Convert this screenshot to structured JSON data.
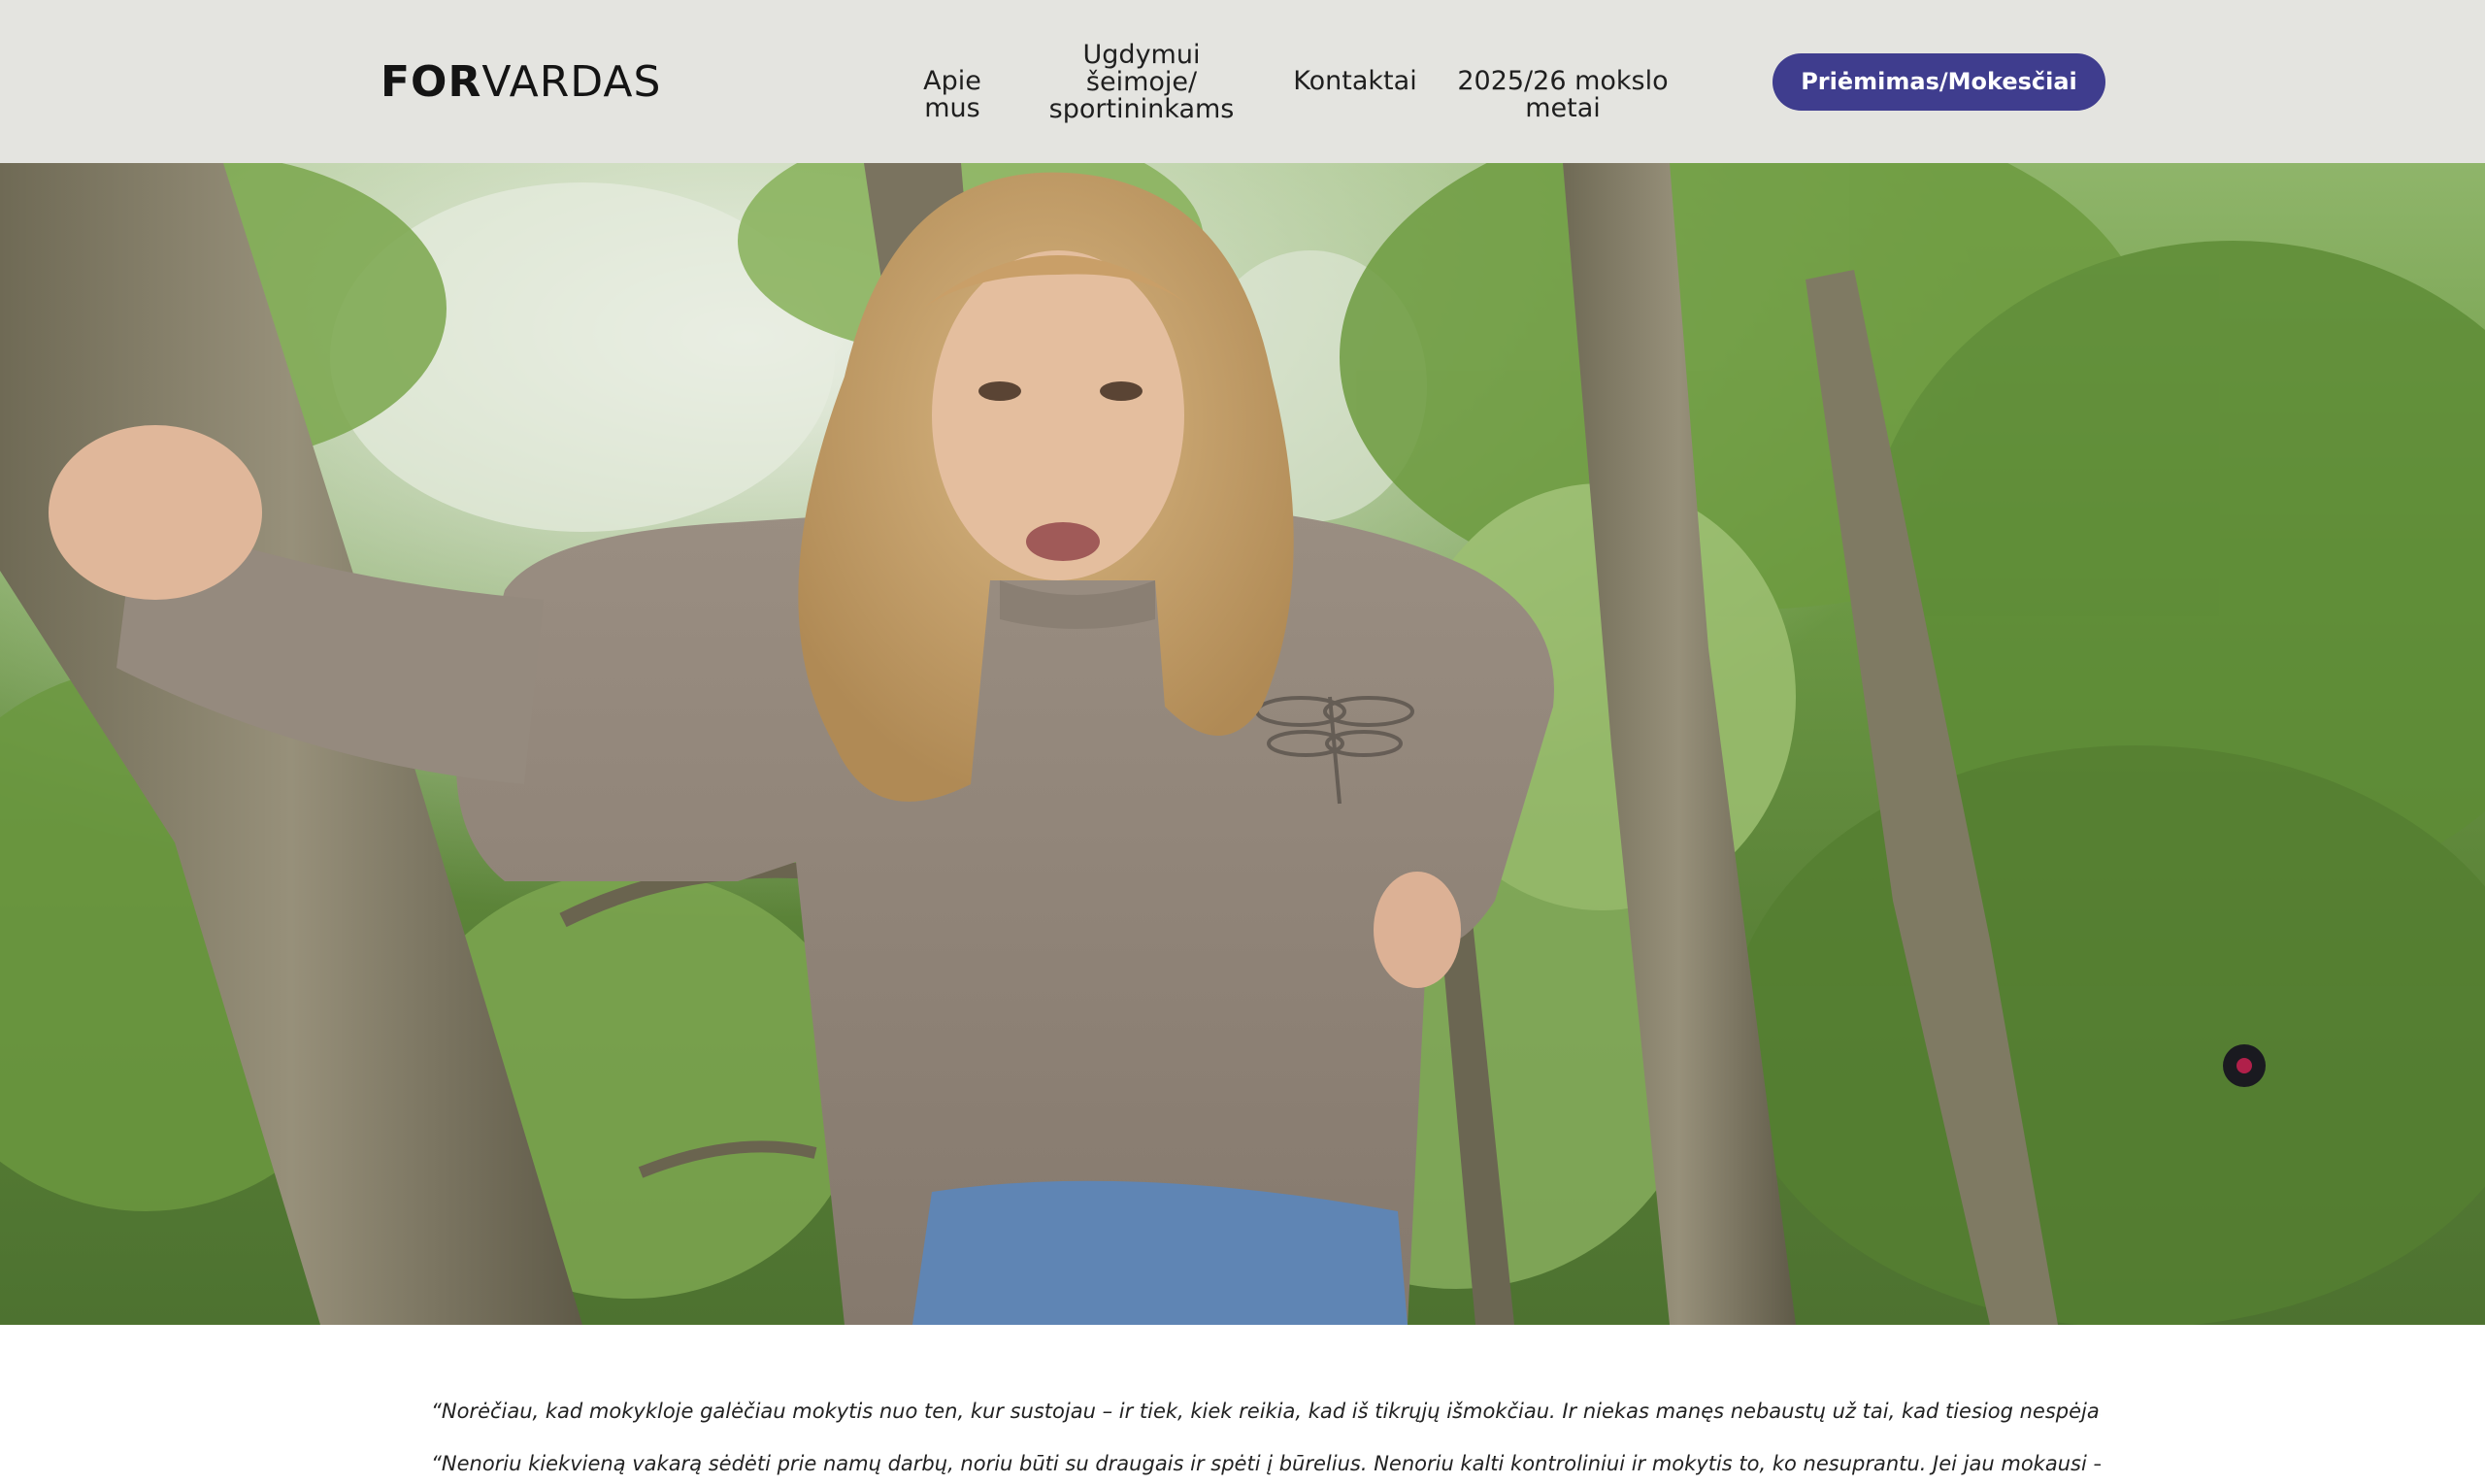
{
  "header": {
    "logo": {
      "bold": "FOR",
      "regular": "VARDAS"
    },
    "nav": {
      "about": "Apie mus",
      "family_line1": "Ugdymui",
      "family_line2": "šeimoje/",
      "family_line3": "sportininkams",
      "contacts": "Kontaktai",
      "school_year": "2025/26 mokslo metai"
    },
    "cta_label": "Priėmimas/Mokesčiai"
  },
  "colors": {
    "header_bg": "#e4e4e0",
    "accent": "#3f3d8e",
    "page_bg": "#ffffff"
  },
  "quotes": [
    "“Norėčiau, kad mokykloje galėčiau mokytis nuo ten, kur sustojau – ir tiek, kiek reikia, kad iš tikrųjų išmokčiau.  Ir niekas manęs nebaustų už tai, kad tiesiog nespėjau išmokti.”",
    "“Nenoriu kiekvieną vakarą sėdėti prie namų darbų, noriu būti su draugais ir spėti į būrelius. Nenoriu kalti kontroliniui ir mokytis to, ko nesuprantu. Jei jau mokausi – noriu žinoti, kam tai"
  ]
}
